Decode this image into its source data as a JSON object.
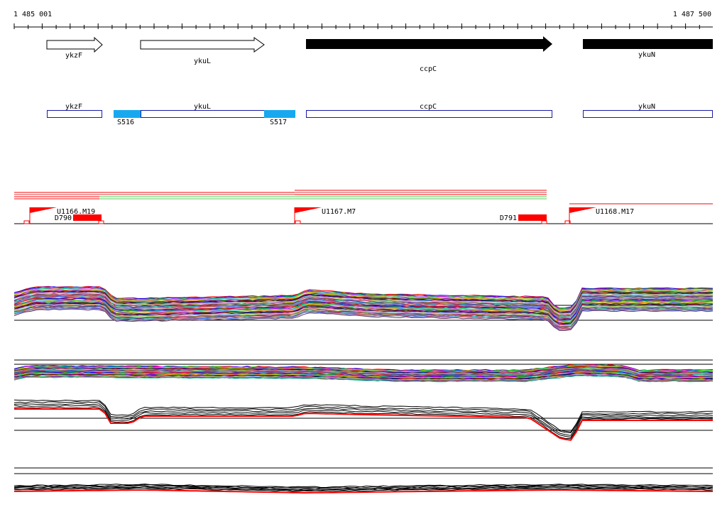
{
  "ruler": {
    "start_label": "1 485 001",
    "end_label": "1 487 500"
  },
  "genes": [
    {
      "name": "ykzF",
      "strand": "+",
      "style": "outline"
    },
    {
      "name": "ykuL",
      "strand": "+",
      "style": "outline"
    },
    {
      "name": "ccpC",
      "strand": "+",
      "style": "filled"
    },
    {
      "name": "ykuN",
      "strand": "+",
      "style": "filled"
    }
  ],
  "annotation_track": {
    "boxes": [
      "ykzF",
      "ykuL",
      "ccpC",
      "ykuN"
    ],
    "sites": [
      "S516",
      "S517"
    ]
  },
  "transcripts": {
    "promoters": [
      "U1166.M19",
      "U1167.M7",
      "U1168.M17"
    ],
    "terminators": [
      "D790",
      "D791"
    ]
  },
  "colors": {
    "gene_fill": "#000000",
    "box_stroke": "#1a1aa8",
    "site_fill": "#18a8f0",
    "promoter": "#ff0000",
    "terminator": "#ff0000",
    "axis": "#000000"
  }
}
